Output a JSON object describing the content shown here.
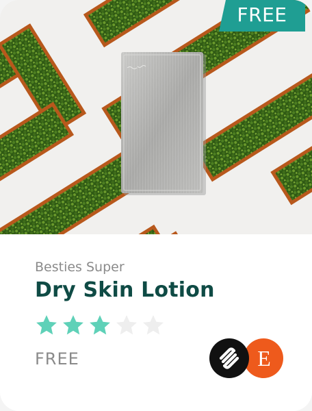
{
  "badge": {
    "label": "FREE",
    "color": "#1f9e93"
  },
  "product": {
    "brand": "Besties Super",
    "title": "Dry Skin Lotion",
    "rating": 3,
    "rating_max": 5,
    "price": "FREE"
  },
  "colors": {
    "title": "#0f4b45",
    "star_filled": "#5fd1b8",
    "star_empty": "#eeeeee",
    "muted_text": "#8a8a8a"
  },
  "platforms": [
    {
      "name": "squarespace-icon",
      "color": "#111111"
    },
    {
      "name": "etsy-icon",
      "color": "#ee5a1c"
    }
  ],
  "etsy_letter": "E"
}
